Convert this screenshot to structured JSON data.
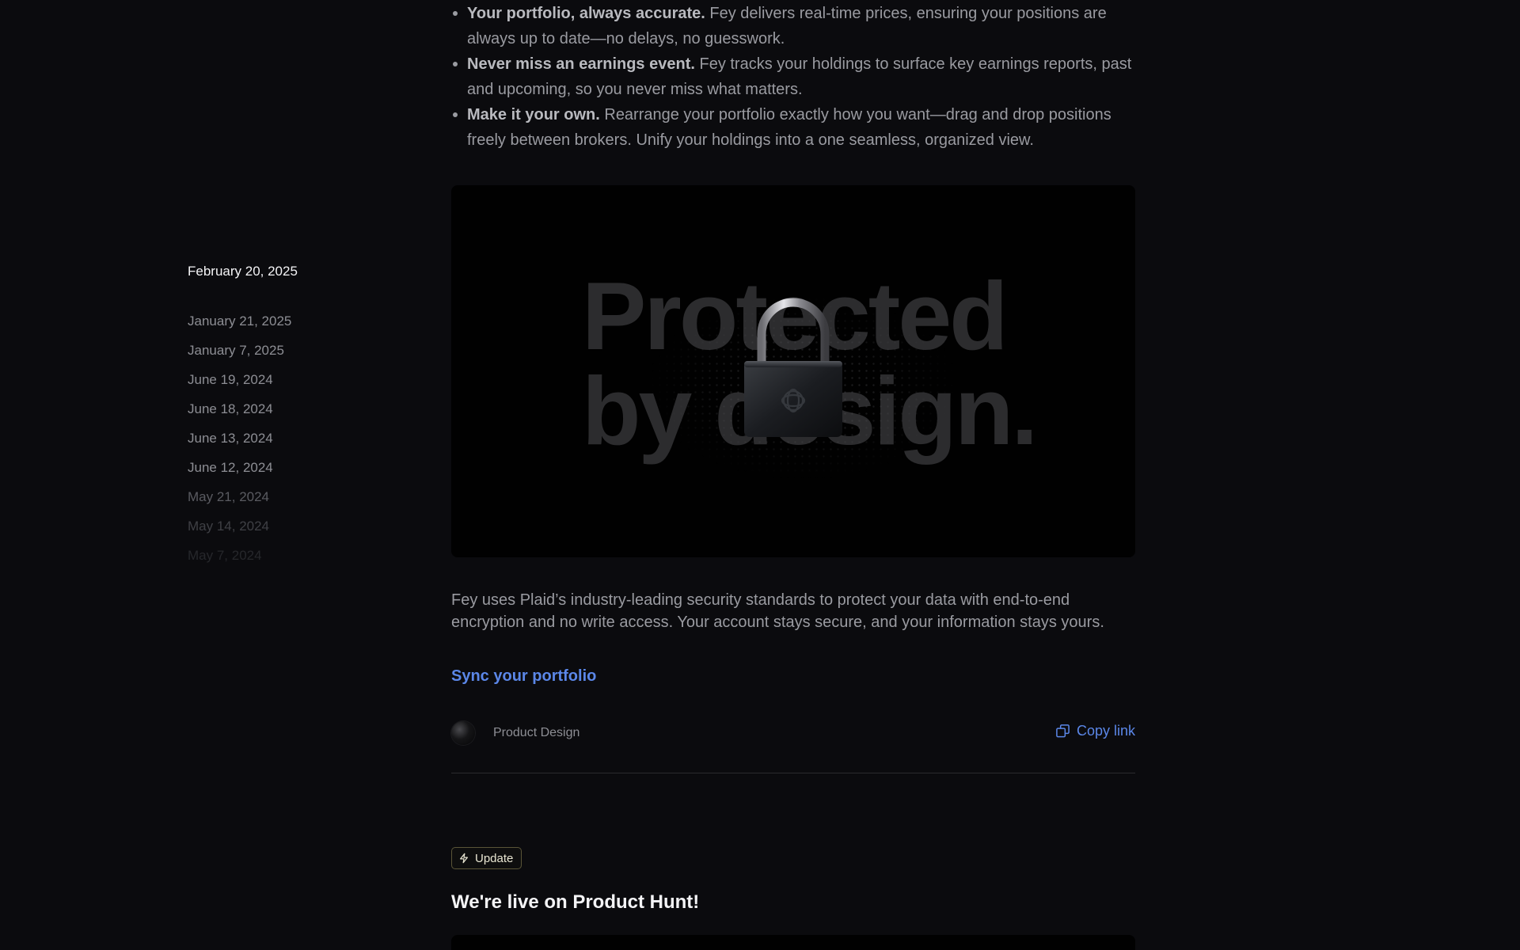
{
  "sidebar": {
    "dates": [
      "February 20, 2025",
      "January 21, 2025",
      "January 7, 2025",
      "June 19, 2024",
      "June 18, 2024",
      "June 13, 2024",
      "June 12, 2024",
      "May 21, 2024",
      "May 14, 2024",
      "May 7, 2024"
    ]
  },
  "post": {
    "bullets": [
      {
        "bold": "Your portfolio, always accurate.",
        "text": " Fey delivers real-time prices, ensuring your positions are always up to date—no delays, no guesswork."
      },
      {
        "bold": "Never miss an earnings event.",
        "text": " Fey tracks your holdings to surface key earnings reports, past and upcoming, so you never miss what matters."
      },
      {
        "bold": "Make it your own.",
        "text": " Rearrange your portfolio exactly how you want—drag and drop positions freely between brokers. Unify your holdings into a one seamless, organized view."
      }
    ],
    "hero": {
      "line1": "Protected",
      "line2": "by design.",
      "icon": "lock-icon"
    },
    "paragraph": "Fey uses Plaid’s industry-leading security standards to protect your data with end-to-end encryption and no write access. Your account stays secure, and your information stays yours.",
    "cta": "Sync your portfolio",
    "category": "Product Design",
    "copy_link": "Copy link"
  },
  "next_post": {
    "badge": "Update",
    "title": "We're live on Product Hunt!"
  },
  "colors": {
    "background": "#0b0b0e",
    "accent_link": "#5b87e8",
    "badge_border": "#5a5537"
  }
}
